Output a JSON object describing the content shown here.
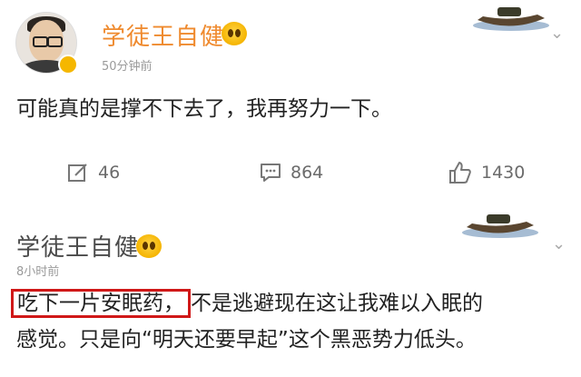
{
  "post1": {
    "author": "学徒王自健",
    "time": "50分钟前",
    "content": "可能真的是撑不下去了，我再努力一下。",
    "repost_count": "46",
    "comment_count": "864",
    "like_count": "1430"
  },
  "post2": {
    "author": "学徒王自健",
    "time": "8小时前",
    "highlight": "吃下一片安眠药，",
    "content_rest": "不是逃避现在这让我难以入眠的",
    "content_line2": "感觉。只是向“明天还要早起”这个黑恶势力低头。"
  },
  "icons": [
    "edit-icon",
    "comment-icon",
    "like-icon",
    "chevron-down-icon",
    "emoji-icon",
    "boat-sticker-icon"
  ],
  "colors": {
    "username_highlight": "#ef8a2e",
    "annotation_box": "#d01818",
    "meta_gray": "#9a9a9a"
  }
}
